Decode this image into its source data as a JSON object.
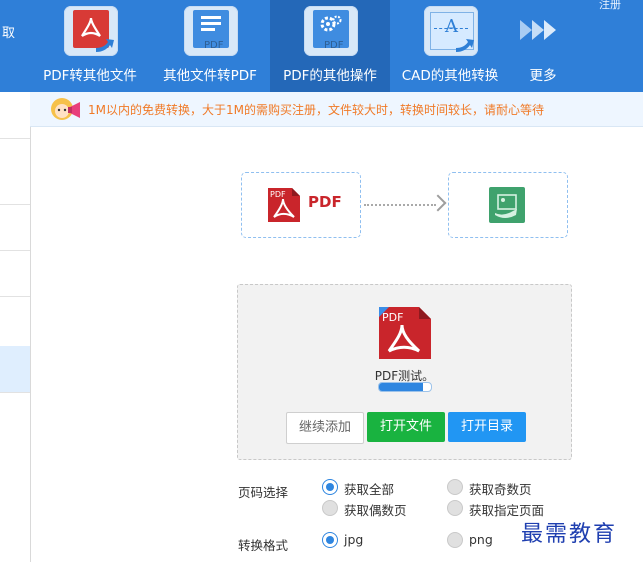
{
  "toolbar": {
    "edge_text": "取",
    "login_text": "注册",
    "tools": [
      {
        "label": "PDF转其他文件",
        "icon": "pdf-to-other-icon"
      },
      {
        "label": "其他文件转PDF",
        "icon": "other-to-pdf-icon"
      },
      {
        "label": "PDF的其他操作",
        "icon": "pdf-settings-icon",
        "active": true
      },
      {
        "label": "CAD的其他转换",
        "icon": "cad-convert-icon"
      },
      {
        "label": "更多",
        "icon": "more-arrows-icon"
      }
    ]
  },
  "notice": {
    "text": "1M以内的免费转换，大于1M的需购买注册，文件较大时，转换时间较长，请耐心等待"
  },
  "flow": {
    "source_label": "PDF",
    "source_icon": "pdf-file-icon",
    "target_icon": "image-file-icon"
  },
  "file": {
    "name": "PDF测试。",
    "icon_text": "PDF",
    "progress_percent": 85
  },
  "buttons": {
    "continue_add": "继续添加",
    "open_file": "打开文件",
    "open_dir": "打开目录"
  },
  "options": {
    "page_select_label": "页码选择",
    "page_options": [
      {
        "label": "获取全部",
        "checked": true
      },
      {
        "label": "获取奇数页",
        "checked": false
      },
      {
        "label": "获取偶数页",
        "checked": false
      },
      {
        "label": "获取指定页面",
        "checked": false
      }
    ],
    "format_label": "转换格式",
    "format_options": [
      {
        "label": "jpg",
        "checked": true
      },
      {
        "label": "png",
        "checked": false
      }
    ]
  },
  "watermark": "最需教育",
  "colors": {
    "toolbar": "#2f7fd8",
    "accent": "#2f86e0",
    "open_file_button": "#19b340",
    "open_dir_button": "#2196f3",
    "notice_text": "#f07a27"
  }
}
